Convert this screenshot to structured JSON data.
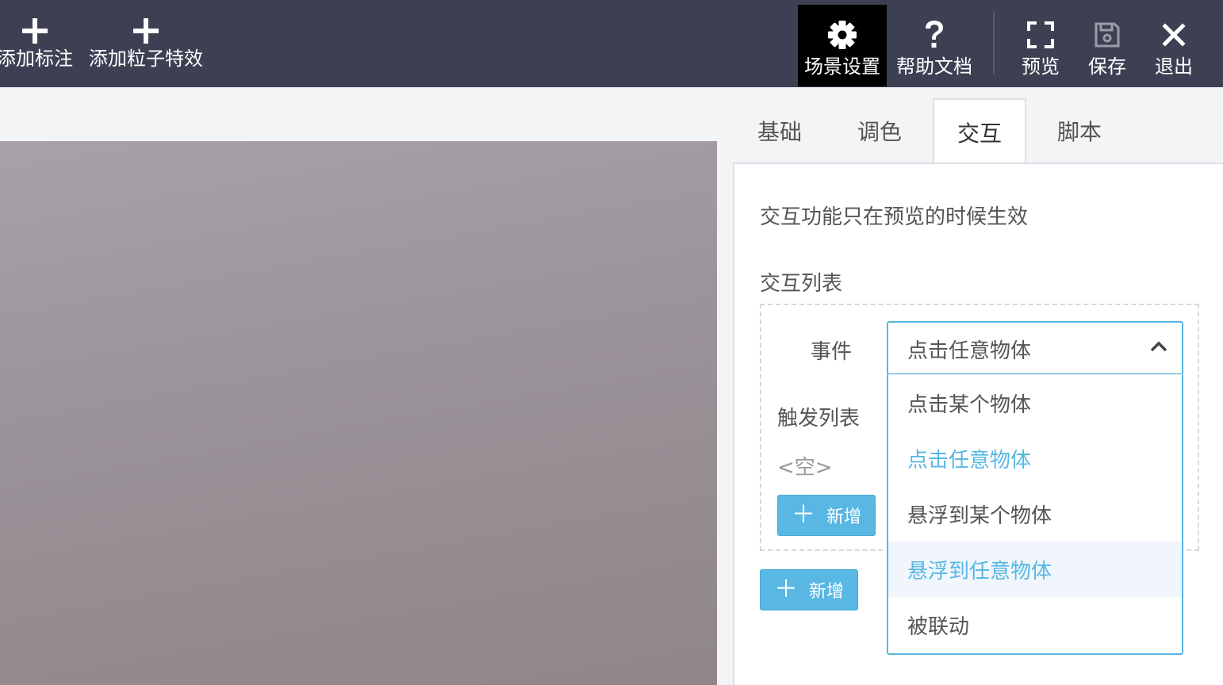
{
  "toolbar": {
    "add_annotation": "添加标注",
    "add_particle": "添加粒子特效",
    "scene_settings": "场景设置",
    "help_docs": "帮助文档",
    "preview": "预览",
    "save": "保存",
    "exit": "退出"
  },
  "tabs": [
    "基础",
    "调色",
    "交互",
    "脚本"
  ],
  "active_tab": "交互",
  "panel": {
    "note": "交互功能只在预览的时候生效",
    "list_title": "交互列表",
    "event_label": "事件",
    "event_value": "点击任意物体",
    "trigger_label": "触发列表",
    "empty": "<空>",
    "add_trigger": "新增",
    "add_interaction": "新增"
  },
  "dropdown": {
    "options": [
      "点击某个物体",
      "点击任意物体",
      "悬浮到某个物体",
      "悬浮到任意物体",
      "被联动"
    ],
    "selected": "点击任意物体",
    "hovered": "悬浮到任意物体"
  },
  "colors": {
    "topbar": "#3d4053",
    "accent": "#58b7e3"
  },
  "icons": {
    "add": "plus-icon",
    "scene_settings": "gear-icon",
    "help": "question-icon",
    "preview": "fullscreen-icon",
    "save": "floppy-disk-icon",
    "exit": "close-icon",
    "select": "chevron-up-icon"
  }
}
